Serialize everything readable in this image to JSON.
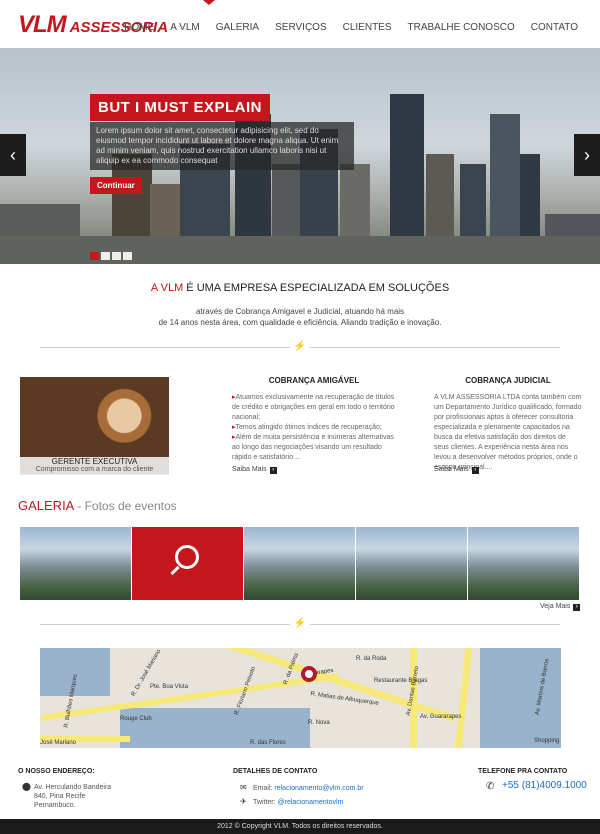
{
  "brand": {
    "name_a": "VLM",
    "name_b": "ASSESSORIA",
    "color": "#c4161c"
  },
  "nav": [
    "HOME",
    "A VLM",
    "GALERIA",
    "SERVIÇOS",
    "CLIENTES",
    "TRABALHE CONOSCO",
    "CONTATO"
  ],
  "hero": {
    "title": "BUT I MUST EXPLAIN",
    "text": "Lorem ipsum dolor sit amet, consectetur adipisicing elit, sed do eiusmod tempor incididunt ut labore et dolore magna aliqua. Ut enim ad minim veniam, quis nostrud exercitation ullamco laboris nisi ut aliquip ex ea commodo consequat",
    "button": "Continuar",
    "prev_icon": "chevron-left-icon",
    "next_icon": "chevron-right-icon"
  },
  "intro": {
    "highlight": "A VLM",
    "headline": "É UMA EMPRESA ESPECIALIZADA EM SOLUÇÕES",
    "line1": "através de Cobrança Amigavel e Judicial, atuando há mais",
    "line2": "de 14 anos nesta área, com qualidade e eficiência. Aliando tradição e inovação."
  },
  "manager": {
    "title": "GERENTE EXECUTIVA",
    "subtitle": "Compromisso com a marca do cliente"
  },
  "services": [
    {
      "title": "COBRANÇA AMIGÁVEL",
      "items": [
        "Atuamos exclusivamente na recuperação de títulos de crédito e obrigações em geral em todo o território nacional;",
        "Temos atingido ótimos índices de recuperação;",
        "Além de muita persistência e inúmeras alternativas ao longo das negociações visando um resultado rápido e satisfatório ..."
      ],
      "more": "Saiba Mais"
    },
    {
      "title": "COBRANÇA JUDICIAL",
      "text": "A VLM ASSESSORIA LTDA conta também com um Departamento Jurídico qualificado, formado por profissionais aptos à oferecer consultoria especializada e plenamente capacitados na busca da efetiva satisfação dos direitos de seus clientes. A experiência nesta área nos levou a desenvolver métodos próprios, onde o escopo principal....",
      "more": "Saiba Mais"
    }
  ],
  "gallery": {
    "title": "GALERIA",
    "subtitle": "- Fotos de eventos",
    "more": "Veja Mais",
    "count": 5,
    "selected_index": 1
  },
  "map": {
    "labels": [
      "R. Bulhões Marques",
      "R. Dr. José Mariano",
      "Pte. Boa Vista",
      "R. Floriano Peixoto",
      "R. da Palma",
      "Guararapes",
      "R. da Roda",
      "R. Matias de Albuquerque",
      "R. Nova",
      "Av. Dantas Barreto",
      "Restaurante Bragas",
      "Av. Guararapes",
      "Av. Martins de Barros",
      "Rouge Club",
      "R. das Flores",
      "Shopping",
      "José Mariano"
    ]
  },
  "footer": {
    "address_title": "O NOSSO ENDEREÇO:",
    "address": [
      "Av. Herculando Bandeira",
      "840, Pina Recife",
      "Pernambuco."
    ],
    "contact_title": "DETALHES DE CONTATO",
    "email_label": "Email:",
    "email": "relacionamento@vlm.com.br",
    "twitter_label": "Twitter:",
    "twitter": "@relacionamentovlm",
    "phone_title": "TELEFONE PRA CONTATO",
    "phone": "+55 (81)4009.1000",
    "copyright": "2012 © Copyright VLM. Todos os direitos reservados."
  }
}
